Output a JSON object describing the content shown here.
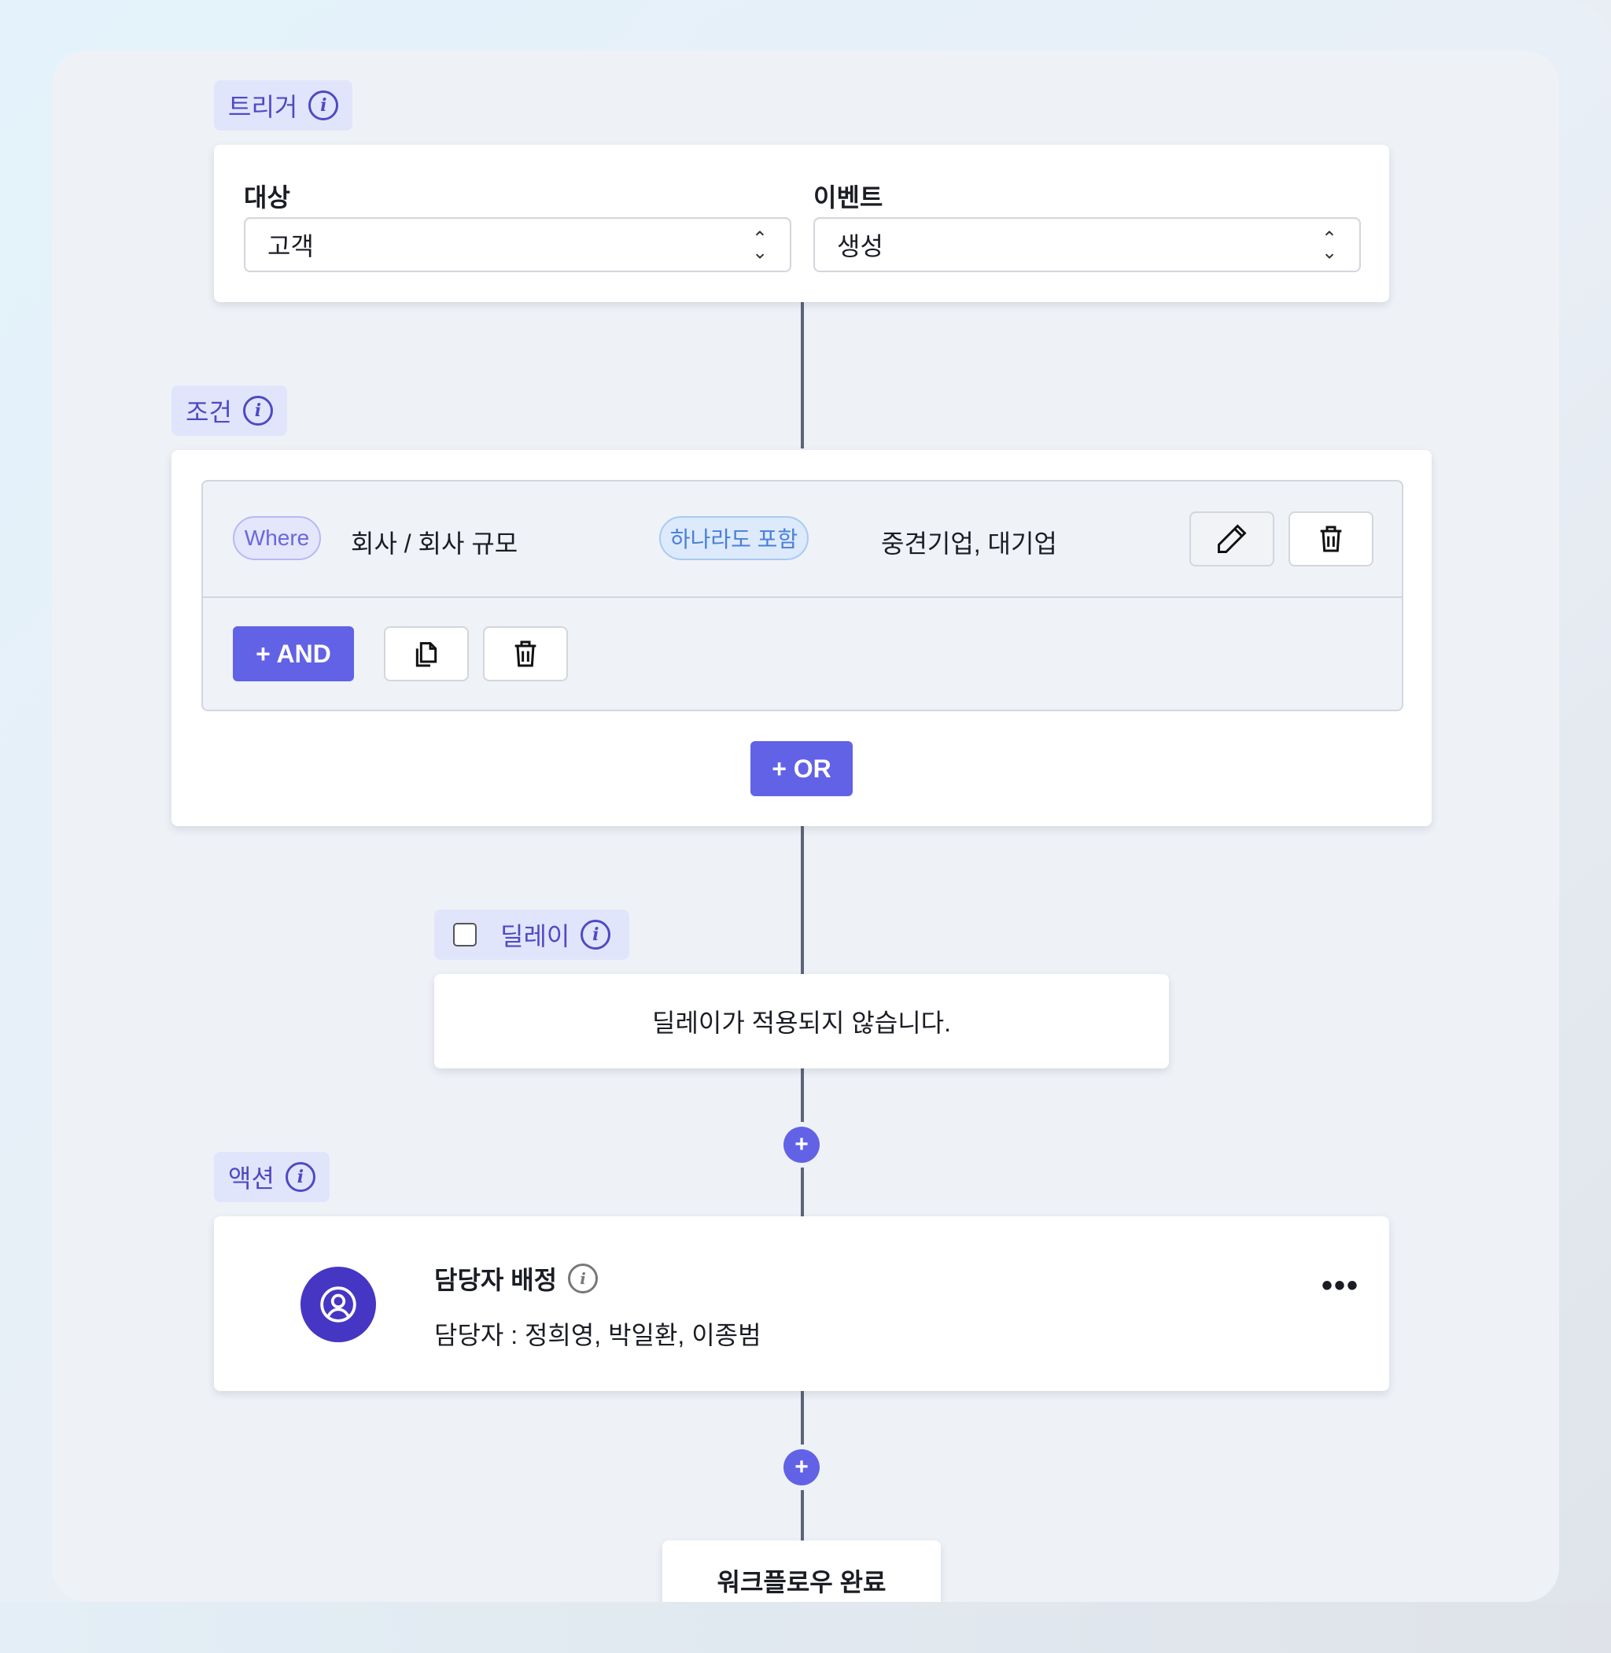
{
  "trigger": {
    "tag_label": "트리거",
    "target_label": "대상",
    "target_value": "고객",
    "event_label": "이벤트",
    "event_value": "생성"
  },
  "condition": {
    "tag_label": "조건",
    "where_label": "Where",
    "field_path": "회사 / 회사 규모",
    "operator": "하나라도 포함",
    "values": "중견기업, 대기업",
    "and_button": "+ AND",
    "or_button": "+ OR"
  },
  "delay": {
    "tag_label": "딜레이",
    "checked": false,
    "message": "딜레이가 적용되지 않습니다."
  },
  "action": {
    "tag_label": "액션",
    "title": "담당자 배정",
    "description": "담당자 : 정희영, 박일환, 이종범",
    "more_label": "•••"
  },
  "end": {
    "label": "워크플로우 완료"
  },
  "icons": {
    "info": "i",
    "plus": "+"
  },
  "colors": {
    "accent": "#6262e6",
    "tag_bg": "#e1e5fb",
    "tag_text": "#4e4ac4",
    "avatar_bg": "#4536c4"
  }
}
